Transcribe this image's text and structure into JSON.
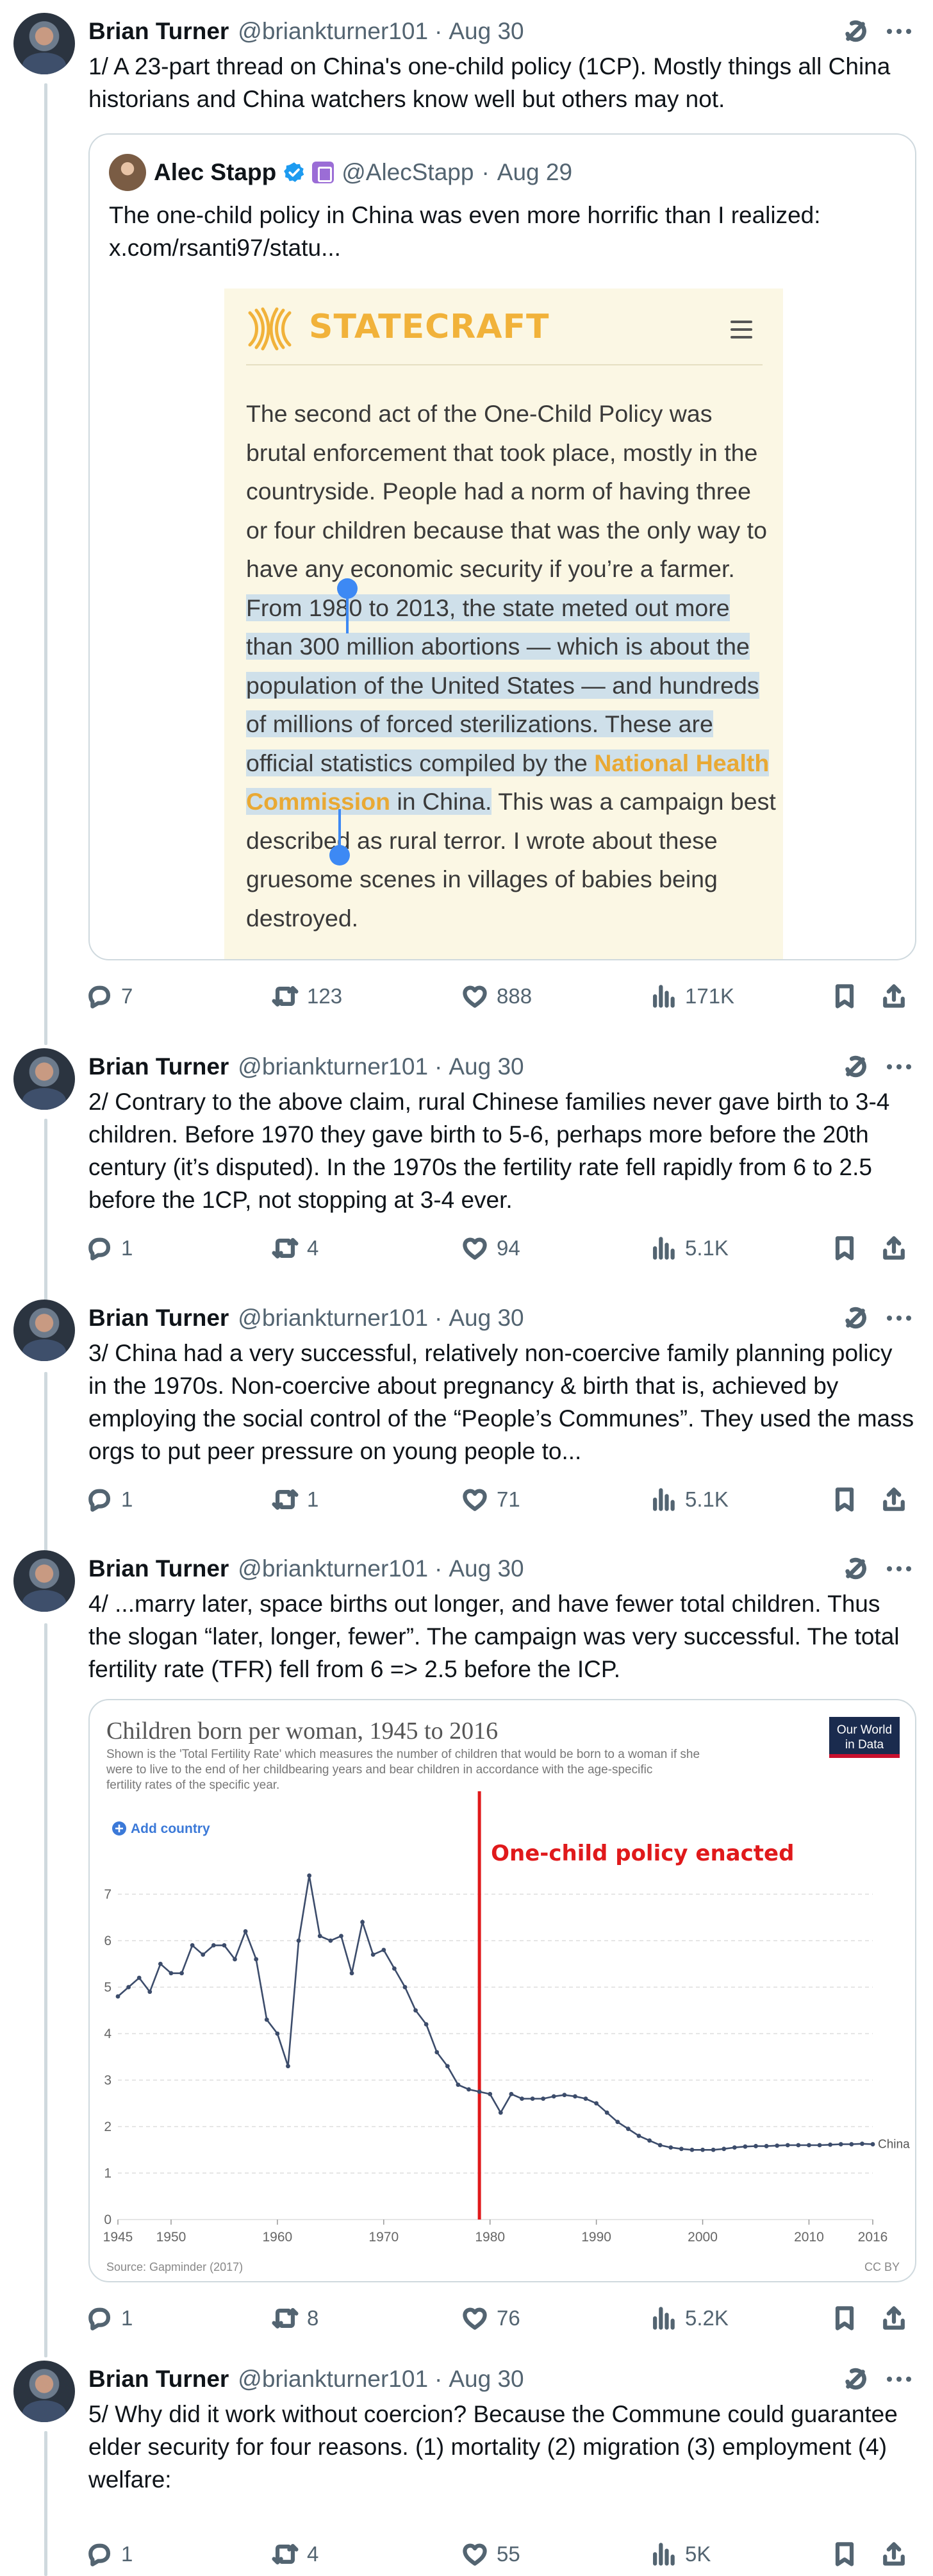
{
  "tweets": [
    {
      "name": "Brian Turner",
      "handle": "@briankturner101",
      "dot": "·",
      "time": "Aug 30",
      "text": "1/ A 23-part thread on China's one-child policy (1CP). Mostly things all China historians and China watchers know well but others may not.",
      "replies": "7",
      "retweets": "123",
      "likes": "888",
      "views": "171K"
    },
    {
      "name": "Brian Turner",
      "handle": "@briankturner101",
      "dot": "·",
      "time": "Aug 30",
      "text": "2/ Contrary to the above claim, rural Chinese families never gave birth to 3-4 children. Before 1970 they gave birth to 5-6, perhaps more before the 20th century (it’s disputed). In the 1970s the fertility rate fell rapidly from 6 to 2.5 before the 1CP, not stopping at 3-4 ever.",
      "replies": "1",
      "retweets": "4",
      "likes": "94",
      "views": "5.1K"
    },
    {
      "name": "Brian Turner",
      "handle": "@briankturner101",
      "dot": "·",
      "time": "Aug 30",
      "text": "3/ China had a very successful, relatively non-coercive family planning policy in the 1970s. Non-coercive about pregnancy & birth that is, achieved by employing the social control of the “People’s Communes”. They used the mass orgs to put peer pressure on young people to...",
      "replies": "1",
      "retweets": "1",
      "likes": "71",
      "views": "5.1K"
    },
    {
      "name": "Brian Turner",
      "handle": "@briankturner101",
      "dot": "·",
      "time": "Aug 30",
      "text": "4/ ...marry later, space births out longer, and have fewer total children. Thus the slogan “later, longer, fewer”. The campaign was very successful. The total fertility rate (TFR) fell from 6 => 2.5 before the ICP.",
      "replies": "1",
      "retweets": "8",
      "likes": "76",
      "views": "5.2K"
    },
    {
      "name": "Brian Turner",
      "handle": "@briankturner101",
      "dot": "·",
      "time": "Aug 30",
      "text": "5/ Why did it work without coercion? Because the Commune could guarantee elder security for four reasons. (1) mortality (2) migration (3) employment (4) welfare:",
      "replies": "1",
      "retweets": "4",
      "likes": "55",
      "views": "5K"
    }
  ],
  "quote": {
    "name": "Alec Stapp",
    "handle": "@AlecStapp",
    "dot": "·",
    "time": "Aug 29",
    "text_line1": "The one-child policy in China was even more horrific than I realized:",
    "text_line2": "x.com/rsanti97/statu...",
    "statecraft": {
      "wordmark": "STATECRAFT",
      "p_before": "The second act of the One-Child Policy was brutal enforcement that took place, mostly in the countryside. People had a norm of having three or four children because that was the only way to have any economic security if you’re a farmer. ",
      "p_highlight": "From 1980 to 2013, the state meted out more than 300 million abortions — which is about the population of the United States — and hundreds of millions of forced sterilizations. These are official statistics compiled by the ",
      "p_link": "National Health Commission",
      "p_highlight_end": " in China.",
      "p_after": " This was a campaign best described as rural terror. I wrote about these gruesome scenes in villages of babies being destroyed."
    }
  },
  "chart_data": {
    "type": "line",
    "title": "Children born per woman, 1945 to 2016",
    "subtitle": "Shown is the 'Total Fertility Rate' which measures the number of children that would be born to a woman if she were to live to the end of her childbearing years and bear children in accordance with the age-specific fertility rates of the specific year.",
    "brand": [
      "Our World",
      "in Data"
    ],
    "add_country": "Add country",
    "annotation": "One-child policy enacted",
    "annotation_year": 1979,
    "source": "Source: Gapminder (2017)",
    "license": "CC BY",
    "xlim": [
      1945,
      2016
    ],
    "ylim": [
      0,
      8
    ],
    "x_ticks": [
      1945,
      1950,
      1960,
      1970,
      1980,
      1990,
      2000,
      2010,
      2016
    ],
    "y_ticks": [
      0,
      1,
      2,
      3,
      4,
      5,
      6,
      7
    ],
    "grid": true,
    "colors": {
      "line": "#3c4c6b",
      "annotation": "#e0191b",
      "brand_bg": "#1a2b4e",
      "brand_bar": "#c8102e"
    },
    "series": [
      {
        "name": "China",
        "x": [
          1945,
          1946,
          1947,
          1948,
          1949,
          1950,
          1951,
          1952,
          1953,
          1954,
          1955,
          1956,
          1957,
          1958,
          1959,
          1960,
          1961,
          1962,
          1963,
          1964,
          1965,
          1966,
          1967,
          1968,
          1969,
          1970,
          1971,
          1972,
          1973,
          1974,
          1975,
          1976,
          1977,
          1978,
          1979,
          1980,
          1981,
          1982,
          1983,
          1984,
          1985,
          1986,
          1987,
          1988,
          1989,
          1990,
          1991,
          1992,
          1993,
          1994,
          1995,
          1996,
          1997,
          1998,
          1999,
          2000,
          2001,
          2002,
          2003,
          2004,
          2005,
          2006,
          2007,
          2008,
          2009,
          2010,
          2011,
          2012,
          2013,
          2014,
          2015,
          2016
        ],
        "y": [
          4.8,
          5.0,
          5.2,
          4.9,
          5.5,
          5.3,
          5.3,
          5.9,
          5.7,
          5.9,
          5.9,
          5.6,
          6.2,
          5.6,
          4.3,
          4.0,
          3.3,
          6.0,
          7.4,
          6.1,
          6.0,
          6.1,
          5.3,
          6.4,
          5.7,
          5.8,
          5.4,
          5.0,
          4.5,
          4.2,
          3.6,
          3.3,
          2.9,
          2.8,
          2.75,
          2.7,
          2.3,
          2.7,
          2.6,
          2.6,
          2.6,
          2.65,
          2.68,
          2.65,
          2.6,
          2.5,
          2.3,
          2.1,
          1.95,
          1.8,
          1.7,
          1.6,
          1.55,
          1.52,
          1.5,
          1.5,
          1.5,
          1.52,
          1.55,
          1.57,
          1.58,
          1.58,
          1.59,
          1.6,
          1.6,
          1.6,
          1.6,
          1.61,
          1.62,
          1.62,
          1.63,
          1.62
        ]
      }
    ]
  }
}
